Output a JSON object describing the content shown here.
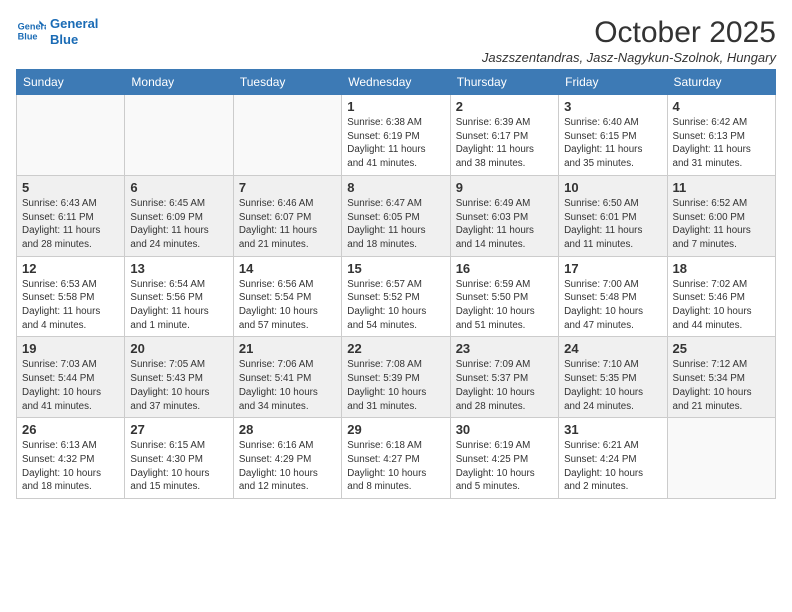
{
  "logo": {
    "line1": "General",
    "line2": "Blue"
  },
  "title": "October 2025",
  "subtitle": "Jaszszentandras, Jasz-Nagykun-Szolnok, Hungary",
  "days_of_week": [
    "Sunday",
    "Monday",
    "Tuesday",
    "Wednesday",
    "Thursday",
    "Friday",
    "Saturday"
  ],
  "weeks": [
    {
      "shaded": false,
      "days": [
        {
          "num": "",
          "info": ""
        },
        {
          "num": "",
          "info": ""
        },
        {
          "num": "",
          "info": ""
        },
        {
          "num": "1",
          "info": "Sunrise: 6:38 AM\nSunset: 6:19 PM\nDaylight: 11 hours\nand 41 minutes."
        },
        {
          "num": "2",
          "info": "Sunrise: 6:39 AM\nSunset: 6:17 PM\nDaylight: 11 hours\nand 38 minutes."
        },
        {
          "num": "3",
          "info": "Sunrise: 6:40 AM\nSunset: 6:15 PM\nDaylight: 11 hours\nand 35 minutes."
        },
        {
          "num": "4",
          "info": "Sunrise: 6:42 AM\nSunset: 6:13 PM\nDaylight: 11 hours\nand 31 minutes."
        }
      ]
    },
    {
      "shaded": true,
      "days": [
        {
          "num": "5",
          "info": "Sunrise: 6:43 AM\nSunset: 6:11 PM\nDaylight: 11 hours\nand 28 minutes."
        },
        {
          "num": "6",
          "info": "Sunrise: 6:45 AM\nSunset: 6:09 PM\nDaylight: 11 hours\nand 24 minutes."
        },
        {
          "num": "7",
          "info": "Sunrise: 6:46 AM\nSunset: 6:07 PM\nDaylight: 11 hours\nand 21 minutes."
        },
        {
          "num": "8",
          "info": "Sunrise: 6:47 AM\nSunset: 6:05 PM\nDaylight: 11 hours\nand 18 minutes."
        },
        {
          "num": "9",
          "info": "Sunrise: 6:49 AM\nSunset: 6:03 PM\nDaylight: 11 hours\nand 14 minutes."
        },
        {
          "num": "10",
          "info": "Sunrise: 6:50 AM\nSunset: 6:01 PM\nDaylight: 11 hours\nand 11 minutes."
        },
        {
          "num": "11",
          "info": "Sunrise: 6:52 AM\nSunset: 6:00 PM\nDaylight: 11 hours\nand 7 minutes."
        }
      ]
    },
    {
      "shaded": false,
      "days": [
        {
          "num": "12",
          "info": "Sunrise: 6:53 AM\nSunset: 5:58 PM\nDaylight: 11 hours\nand 4 minutes."
        },
        {
          "num": "13",
          "info": "Sunrise: 6:54 AM\nSunset: 5:56 PM\nDaylight: 11 hours\nand 1 minute."
        },
        {
          "num": "14",
          "info": "Sunrise: 6:56 AM\nSunset: 5:54 PM\nDaylight: 10 hours\nand 57 minutes."
        },
        {
          "num": "15",
          "info": "Sunrise: 6:57 AM\nSunset: 5:52 PM\nDaylight: 10 hours\nand 54 minutes."
        },
        {
          "num": "16",
          "info": "Sunrise: 6:59 AM\nSunset: 5:50 PM\nDaylight: 10 hours\nand 51 minutes."
        },
        {
          "num": "17",
          "info": "Sunrise: 7:00 AM\nSunset: 5:48 PM\nDaylight: 10 hours\nand 47 minutes."
        },
        {
          "num": "18",
          "info": "Sunrise: 7:02 AM\nSunset: 5:46 PM\nDaylight: 10 hours\nand 44 minutes."
        }
      ]
    },
    {
      "shaded": true,
      "days": [
        {
          "num": "19",
          "info": "Sunrise: 7:03 AM\nSunset: 5:44 PM\nDaylight: 10 hours\nand 41 minutes."
        },
        {
          "num": "20",
          "info": "Sunrise: 7:05 AM\nSunset: 5:43 PM\nDaylight: 10 hours\nand 37 minutes."
        },
        {
          "num": "21",
          "info": "Sunrise: 7:06 AM\nSunset: 5:41 PM\nDaylight: 10 hours\nand 34 minutes."
        },
        {
          "num": "22",
          "info": "Sunrise: 7:08 AM\nSunset: 5:39 PM\nDaylight: 10 hours\nand 31 minutes."
        },
        {
          "num": "23",
          "info": "Sunrise: 7:09 AM\nSunset: 5:37 PM\nDaylight: 10 hours\nand 28 minutes."
        },
        {
          "num": "24",
          "info": "Sunrise: 7:10 AM\nSunset: 5:35 PM\nDaylight: 10 hours\nand 24 minutes."
        },
        {
          "num": "25",
          "info": "Sunrise: 7:12 AM\nSunset: 5:34 PM\nDaylight: 10 hours\nand 21 minutes."
        }
      ]
    },
    {
      "shaded": false,
      "days": [
        {
          "num": "26",
          "info": "Sunrise: 6:13 AM\nSunset: 4:32 PM\nDaylight: 10 hours\nand 18 minutes."
        },
        {
          "num": "27",
          "info": "Sunrise: 6:15 AM\nSunset: 4:30 PM\nDaylight: 10 hours\nand 15 minutes."
        },
        {
          "num": "28",
          "info": "Sunrise: 6:16 AM\nSunset: 4:29 PM\nDaylight: 10 hours\nand 12 minutes."
        },
        {
          "num": "29",
          "info": "Sunrise: 6:18 AM\nSunset: 4:27 PM\nDaylight: 10 hours\nand 8 minutes."
        },
        {
          "num": "30",
          "info": "Sunrise: 6:19 AM\nSunset: 4:25 PM\nDaylight: 10 hours\nand 5 minutes."
        },
        {
          "num": "31",
          "info": "Sunrise: 6:21 AM\nSunset: 4:24 PM\nDaylight: 10 hours\nand 2 minutes."
        },
        {
          "num": "",
          "info": ""
        }
      ]
    }
  ]
}
